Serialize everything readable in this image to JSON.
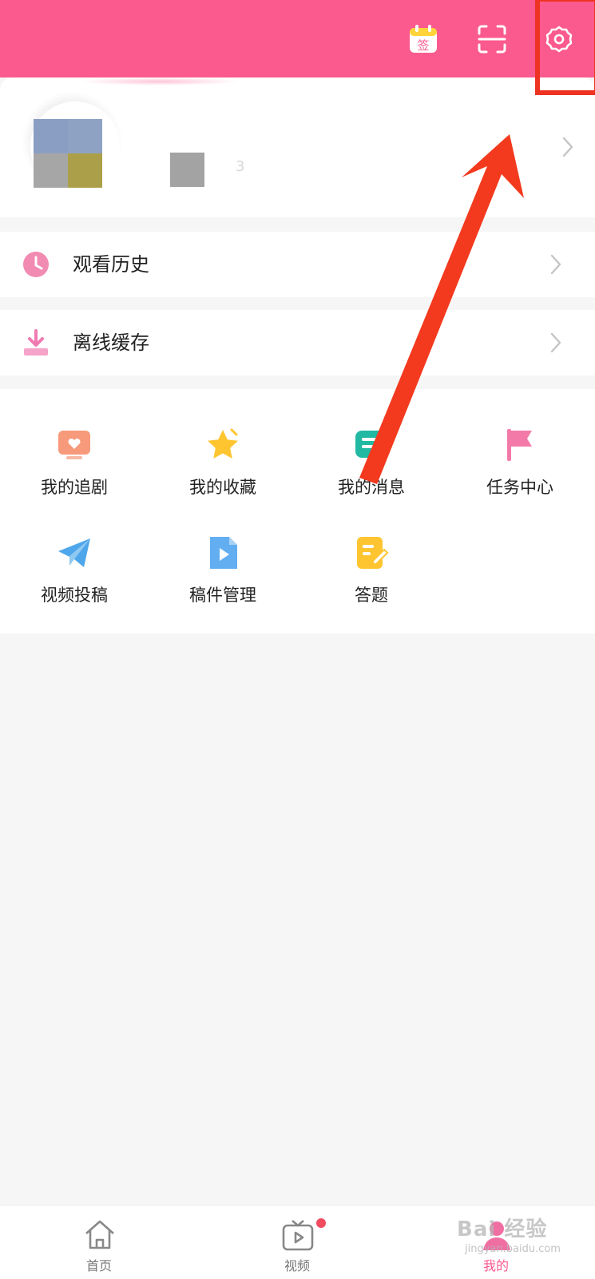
{
  "header": {
    "sign_label": "签",
    "colors": {
      "brand": "#fb5a8e"
    }
  },
  "profile": {
    "avatar_colors": [
      "#8a9ec4",
      "#8ea2c4",
      "#a6a6a6",
      "#aba049"
    ],
    "nickname_tail": "3"
  },
  "list_rows": [
    {
      "label": "观看历史",
      "icon": "clock-icon"
    },
    {
      "label": "离线缓存",
      "icon": "download-icon"
    }
  ],
  "grid": [
    {
      "label": "我的追剧",
      "icon": "tv-heart-icon"
    },
    {
      "label": "我的收藏",
      "icon": "star-icon"
    },
    {
      "label": "我的消息",
      "icon": "message-icon"
    },
    {
      "label": "任务中心",
      "icon": "flag-icon"
    },
    {
      "label": "视频投稿",
      "icon": "paper-plane-icon"
    },
    {
      "label": "稿件管理",
      "icon": "video-file-icon"
    },
    {
      "label": "答题",
      "icon": "quiz-icon"
    }
  ],
  "tabs": [
    {
      "label": "首页",
      "icon": "home-icon"
    },
    {
      "label": "视频",
      "icon": "tv-play-icon"
    },
    {
      "label": "我的",
      "icon": "profile-icon"
    }
  ],
  "watermark": {
    "text": "Bai 经验",
    "sub": "jingyan.baidu.com"
  }
}
